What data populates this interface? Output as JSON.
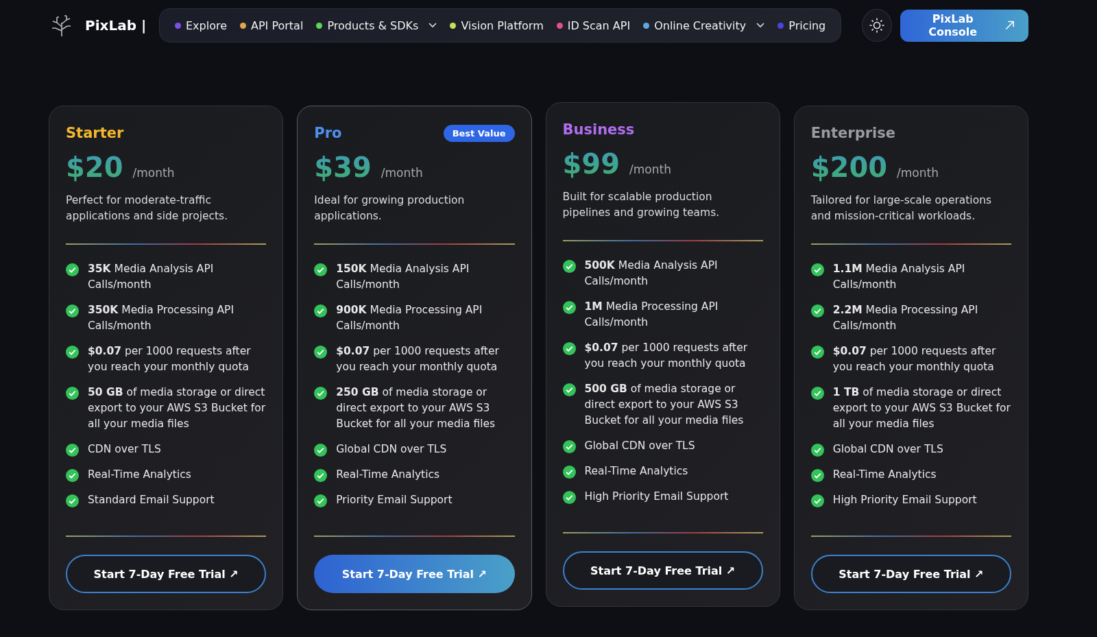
{
  "brand": {
    "name": "PixLab |"
  },
  "nav": [
    {
      "label": "Explore",
      "color": "#7b4fe8",
      "has_menu": false
    },
    {
      "label": "API Portal",
      "color": "#e0a64b",
      "has_menu": false
    },
    {
      "label": "Products & SDKs",
      "color": "#5fd35a",
      "has_menu": true
    },
    {
      "label": "Vision Platform",
      "color": "#c6e05a",
      "has_menu": false
    },
    {
      "label": "ID Scan API",
      "color": "#e0508a",
      "has_menu": false
    },
    {
      "label": "Online Creativity",
      "color": "#5aa8e8",
      "has_menu": true
    },
    {
      "label": "Pricing",
      "color": "#4a44e0",
      "has_menu": false
    }
  ],
  "console_button": {
    "label": "PixLab Console"
  },
  "plans": [
    {
      "name": "Starter",
      "color": "#f5b82e",
      "price": "$20",
      "period": "/month",
      "description": "Perfect for moderate-traffic applications and side projects.",
      "featured": false,
      "raised": false,
      "features": [
        "**35K** Media Analysis API Calls/month",
        "**350K** Media Processing API Calls/month",
        "**$0.07** per 1000 requests after you reach your monthly quota",
        "**50 GB** of media storage or direct export to your AWS S3 Bucket for all your media files",
        "CDN over TLS",
        "Real-Time Analytics",
        "Standard Email Support"
      ],
      "cta": "Start 7-Day Free Trial ↗"
    },
    {
      "name": "Pro",
      "color": "#4f8ff0",
      "price": "$39",
      "period": "/month",
      "description": "Ideal for growing production applications.",
      "featured": true,
      "badge": "Best Value",
      "raised": false,
      "features": [
        "**150K** Media Analysis API Calls/month",
        "**900K** Media Processing API Calls/month",
        "**$0.07** per 1000 requests after you reach your monthly quota",
        "**250 GB** of media storage or direct export to your AWS S3 Bucket for all your media files",
        "Global CDN over TLS",
        "Real-Time Analytics",
        "Priority Email Support"
      ],
      "cta": "Start 7-Day Free Trial ↗"
    },
    {
      "name": "Business",
      "color": "#b06ef0",
      "price": "$99",
      "period": "/month",
      "description": "Built for scalable production pipelines and growing teams.",
      "featured": false,
      "raised": true,
      "features": [
        "**500K** Media Analysis API Calls/month",
        "**1M** Media Processing API Calls/month",
        "**$0.07** per 1000 requests after you reach your monthly quota",
        "**500 GB** of media storage or direct export to your AWS S3 Bucket for all your media files",
        "Global CDN over TLS",
        "Real-Time Analytics",
        "High Priority Email Support"
      ],
      "cta": "Start 7-Day Free Trial ↗"
    },
    {
      "name": "Enterprise",
      "color": "#9a9aa0",
      "price": "$200",
      "period": "/month",
      "description": "Tailored for large-scale operations and mission-critical workloads.",
      "featured": false,
      "raised": false,
      "features": [
        "**1.1M** Media Analysis API Calls/month",
        "**2.2M** Media Processing API Calls/month",
        "**$0.07** per 1000 requests after you reach your monthly quota",
        "**1 TB** of media storage or direct export to your AWS S3 Bucket for all your media files",
        "Global CDN over TLS",
        "Real-Time Analytics",
        "High Priority Email Support"
      ],
      "cta": "Start 7-Day Free Trial ↗"
    }
  ]
}
